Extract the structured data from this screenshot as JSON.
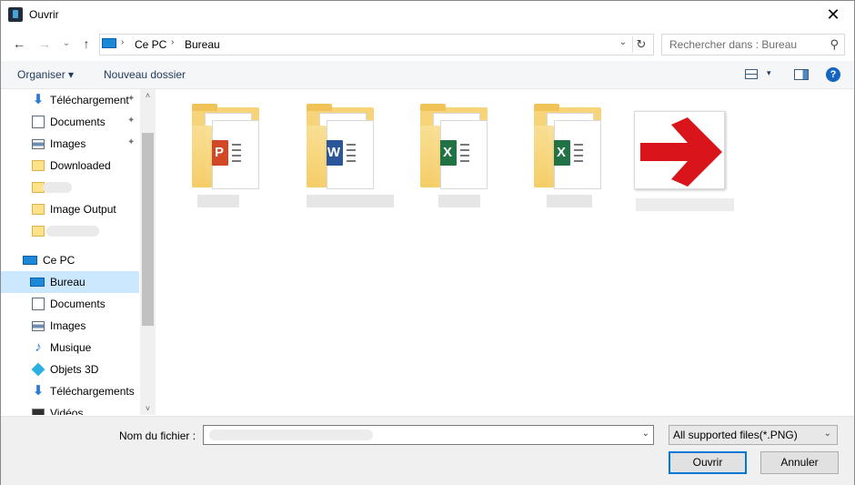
{
  "window": {
    "title": "Ouvrir",
    "close_glyph": "✕"
  },
  "nav": {
    "back_glyph": "←",
    "forward_glyph": "→",
    "recent_glyph": "⌄",
    "up_glyph": "↑",
    "breadcrumb": [
      "Ce PC",
      "Bureau"
    ],
    "sep_glyph": "›",
    "drop_glyph": "⌄",
    "refresh_glyph": "↻"
  },
  "search": {
    "placeholder": "Rechercher dans : Bureau",
    "icon": "search-icon",
    "glyph": "⚲"
  },
  "toolbar": {
    "organize_label": "Organiser ▾",
    "new_folder_label": "Nouveau dossier",
    "help_glyph": "?",
    "view_drop_glyph": "▾"
  },
  "sidebar": {
    "items": [
      {
        "label": "Téléchargement",
        "icon": "download-icon",
        "pinned": true
      },
      {
        "label": "Documents",
        "icon": "documents-icon",
        "pinned": true
      },
      {
        "label": "Images",
        "icon": "images-icon",
        "pinned": true
      },
      {
        "label": "Downloaded",
        "icon": "folder-icon",
        "pinned": false
      },
      {
        "label": "",
        "icon": "folder-icon",
        "pinned": false
      },
      {
        "label": "Image Output",
        "icon": "folder-icon",
        "pinned": false
      },
      {
        "label": "",
        "icon": "folder-icon",
        "pinned": false
      },
      {
        "label": "Ce PC",
        "icon": "pc-icon",
        "pinned": false
      },
      {
        "label": "Bureau",
        "icon": "desktop-icon",
        "pinned": false,
        "selected": true
      },
      {
        "label": "Documents",
        "icon": "documents-icon",
        "pinned": false
      },
      {
        "label": "Images",
        "icon": "images-icon",
        "pinned": false
      },
      {
        "label": "Musique",
        "icon": "music-icon",
        "pinned": false
      },
      {
        "label": "Objets 3D",
        "icon": "objects3d-icon",
        "pinned": false
      },
      {
        "label": "Téléchargements",
        "icon": "download-icon",
        "pinned": false
      },
      {
        "label": "Vidéos",
        "icon": "videos-icon",
        "pinned": false
      }
    ],
    "pin_glyph": "📌",
    "scroll_up_glyph": "˄",
    "scroll_down_glyph": "˅"
  },
  "files": [
    {
      "type": "folder",
      "badge": "powerpoint",
      "badge_letter": "P",
      "badge_color": "#d24726"
    },
    {
      "type": "folder",
      "badge": "word",
      "badge_letter": "W",
      "badge_color": "#2b579a"
    },
    {
      "type": "folder",
      "badge": "excel",
      "badge_letter": "X",
      "badge_color": "#217346"
    },
    {
      "type": "folder",
      "badge": "excel",
      "badge_letter": "X",
      "badge_color": "#217346"
    },
    {
      "type": "image",
      "badge": "red-arrow",
      "arrow_color": "#d9141a"
    }
  ],
  "bottom": {
    "filename_label": "Nom du fichier :",
    "filename_value": "",
    "filter_label": "All supported files(*.PNG)",
    "open_label": "Ouvrir",
    "cancel_label": "Annuler",
    "drop_glyph": "⌄"
  },
  "colors": {
    "selection": "#cce8ff",
    "accent": "#0078d7",
    "arrow": "#d9141a"
  }
}
